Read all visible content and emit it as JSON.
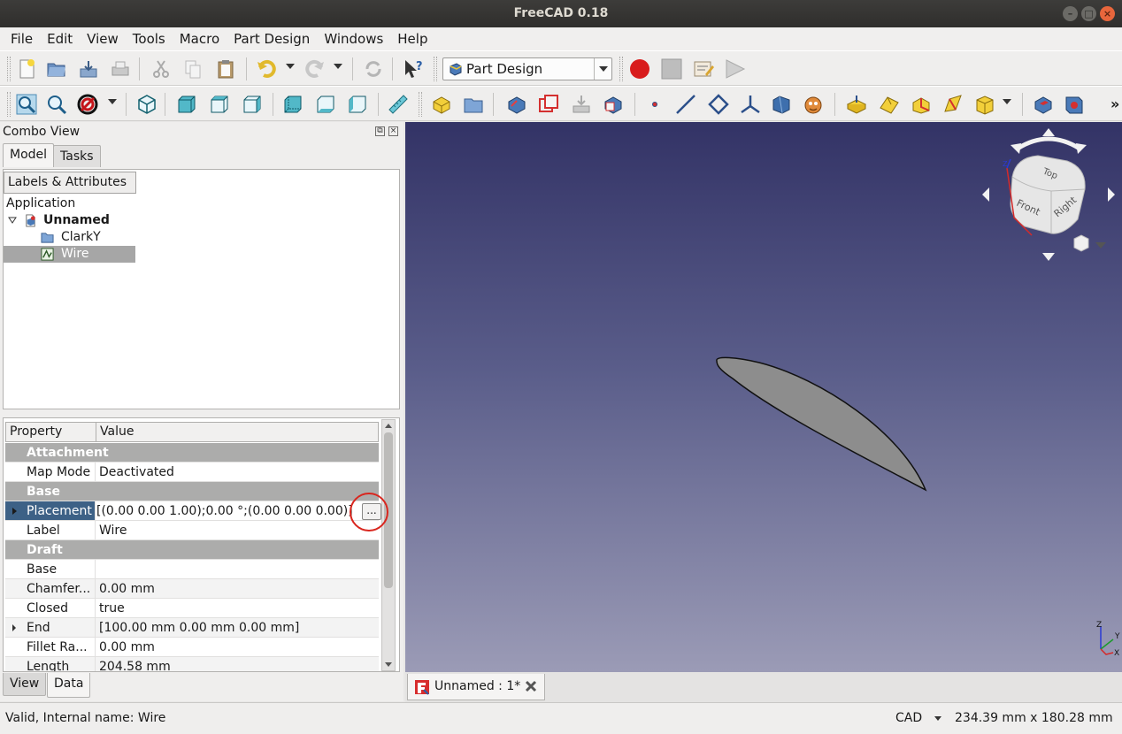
{
  "window": {
    "title": "FreeCAD 0.18"
  },
  "menu": [
    {
      "label": "File"
    },
    {
      "label": "Edit"
    },
    {
      "label": "View"
    },
    {
      "label": "Tools"
    },
    {
      "label": "Macro"
    },
    {
      "label": "Part Design"
    },
    {
      "label": "Windows"
    },
    {
      "label": "Help"
    }
  ],
  "workbench": {
    "selected": "Part Design"
  },
  "combo_view": {
    "title": "Combo View",
    "tabs": [
      "Model",
      "Tasks"
    ],
    "tree_header": "Labels & Attributes",
    "tree": {
      "root": "Application",
      "document": "Unnamed",
      "items": [
        "ClarkY",
        "Wire"
      ]
    },
    "property_header": {
      "property": "Property",
      "value": "Value"
    },
    "properties": [
      {
        "group": "Attachment"
      },
      {
        "name": "Map Mode",
        "value": "Deactivated"
      },
      {
        "group": "Base"
      },
      {
        "name": "Placement",
        "value": "[(0.00 0.00 1.00);0.00 °;(0.00 0.00 0.00)]",
        "button": "..."
      },
      {
        "name": "Label",
        "value": "Wire"
      },
      {
        "group": "Draft"
      },
      {
        "name": "Base",
        "value": ""
      },
      {
        "name": "Chamfer...",
        "value": "0.00 mm"
      },
      {
        "name": "Closed",
        "value": "true"
      },
      {
        "name": "End",
        "value": "[100.00 mm  0.00 mm  0.00 mm]"
      },
      {
        "name": "Fillet Ra...",
        "value": "0.00 mm"
      },
      {
        "name": "Length",
        "value": "204.58 mm"
      }
    ],
    "bottom_tabs": [
      "View",
      "Data"
    ]
  },
  "navcube": {
    "faces": [
      "Top",
      "Front",
      "Right"
    ],
    "axes": [
      "X",
      "Y",
      "Z"
    ]
  },
  "document_tab": {
    "label": "Unnamed : 1*"
  },
  "status": {
    "message": "Valid, Internal name: Wire",
    "nav_style": "CAD",
    "dimensions": "234.39 mm x 180.28 mm"
  }
}
